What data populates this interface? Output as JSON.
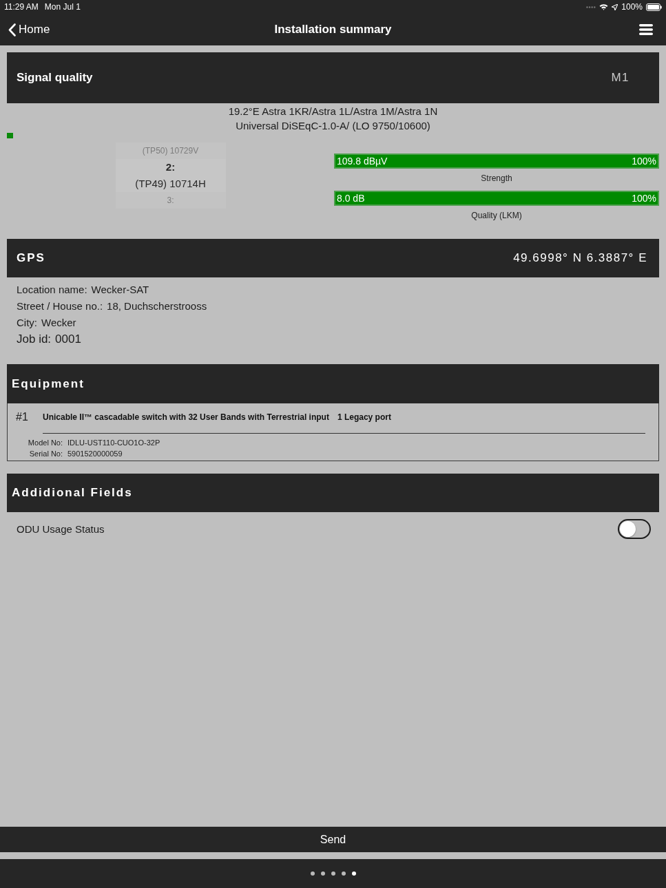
{
  "status_bar": {
    "time": "11:29 AM",
    "date": "Mon Jul 1",
    "battery": "100%"
  },
  "nav": {
    "back": "Home",
    "title": "Installation summary"
  },
  "signal_quality": {
    "title": "Signal quality",
    "mode": "M1",
    "satellite": "19.2°E Astra 1KR/Astra 1L/Astra 1M/Astra 1N",
    "lnb": "Universal DiSEqC-1.0-A/ (LO 9750/10600)",
    "transponders": [
      {
        "frequency": "(TP50) 10729V",
        "selected": false
      },
      {
        "number": "2:",
        "frequency": "(TP49) 10714H",
        "selected": true
      },
      {
        "number": "3:",
        "selected": false
      }
    ],
    "meters": [
      {
        "reading": "109.8 dBµV",
        "percent": "100%",
        "level": 1,
        "label": "Strength"
      },
      {
        "reading": "8.0 dB",
        "percent": "100%",
        "level": 1,
        "label": "Quality (LKM)"
      }
    ]
  },
  "gps": {
    "title": "GPS",
    "coordinates": "49.6998° N 6.3887° E",
    "fields": [
      {
        "kind": "line",
        "label": "Location name:",
        "value": "Wecker-SAT"
      },
      {
        "kind": "line",
        "label": "Street / House no.:",
        "value": "18, Duchscherstrooss"
      },
      {
        "kind": "line",
        "label": "City:",
        "value": "Wecker"
      },
      {
        "kind": "large",
        "label": "Job id:",
        "value": "0001"
      }
    ]
  },
  "equipment": {
    "title": "Equipment",
    "items": [
      {
        "number": "#1",
        "description": "Unicable II™ cascadable switch with 32 User Bands with Terrestrial input",
        "ports": "1 Legacy port",
        "model_label": "Model No:",
        "model": "IDLU-UST110-CUO1O-32P",
        "serial_label": "Serial No:",
        "serial": "5901520000059"
      }
    ]
  },
  "additional_fields": {
    "title": "Addidional Fields",
    "fields": [
      {
        "label": "ODU Usage Status",
        "on": false
      }
    ]
  },
  "send_button": "Send",
  "pages": [
    {
      "selected": false
    },
    {
      "selected": false
    },
    {
      "selected": false
    },
    {
      "selected": false
    },
    {
      "selected": true
    }
  ]
}
